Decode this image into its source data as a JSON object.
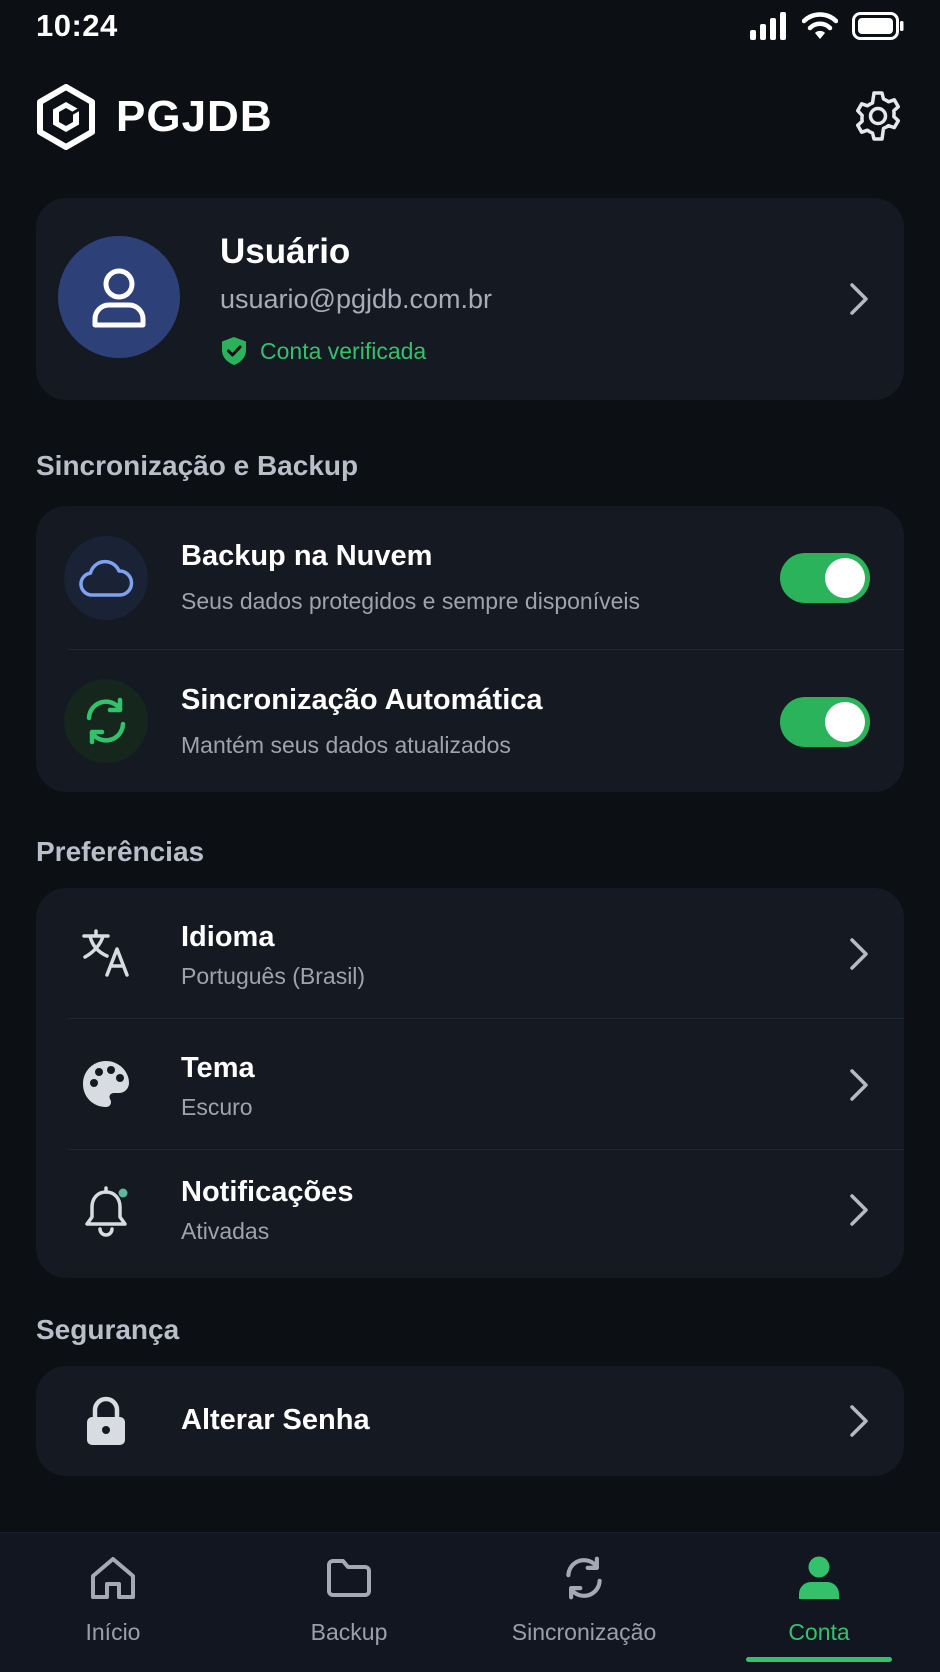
{
  "status_bar": {
    "time": "10:24"
  },
  "header": {
    "app_name": "PGJDB"
  },
  "profile": {
    "name": "Usuário",
    "email": "usuario@pgjdb.com.br",
    "badge": "Conta verificada"
  },
  "sections": {
    "sync": {
      "title": "Sincronização e Backup",
      "items": [
        {
          "title": "Backup na Nuvem",
          "subtitle": "Seus dados protegidos e sempre disponíveis",
          "enabled": true
        },
        {
          "title": "Sincronização Automática",
          "subtitle": "Mantém seus dados atualizados",
          "enabled": true
        }
      ]
    },
    "preferences": {
      "title": "Preferências",
      "items": [
        {
          "title": "Idioma",
          "value": "Português (Brasil)"
        },
        {
          "title": "Tema",
          "value": "Escuro"
        },
        {
          "title": "Notificações",
          "value": "Ativadas"
        }
      ]
    },
    "security": {
      "title": "Segurança",
      "items": [
        {
          "title": "Alterar Senha"
        }
      ]
    }
  },
  "bottom_nav": {
    "items": [
      {
        "label": "Início",
        "icon": "home-icon"
      },
      {
        "label": "Backup",
        "icon": "folder-icon"
      },
      {
        "label": "Sincronização",
        "icon": "sync-icon"
      },
      {
        "label": "Conta",
        "icon": "user-icon",
        "active": true
      }
    ]
  },
  "colors": {
    "background": "#0c0f14",
    "card": "#141922",
    "accent_green": "#33c26b",
    "toggle_on": "#2bb35c",
    "avatar_bg": "#2d4178",
    "cloud_blue": "#7ea2f0"
  }
}
